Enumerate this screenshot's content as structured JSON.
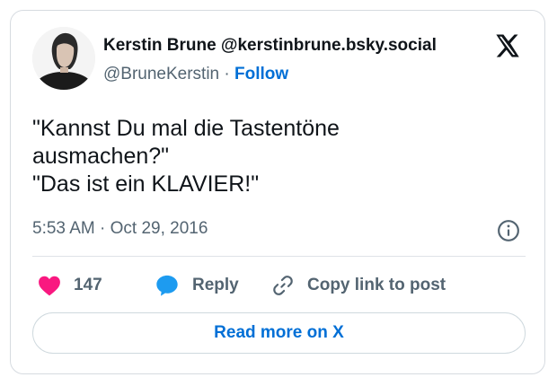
{
  "author": {
    "display_name": "Kerstin Brune",
    "bsky_handle": "@kerstinbrune.bsky.social",
    "x_handle": "@BruneKerstin",
    "separator": "·",
    "follow_label": "Follow"
  },
  "tweet": {
    "lines": [
      "\"Kannst Du mal die Tastentöne",
      "ausmachen?\"",
      "\"Das ist ein KLAVIER!\""
    ]
  },
  "meta": {
    "time": "5:53 AM",
    "separator": "·",
    "date": "Oct 29, 2016"
  },
  "actions": {
    "like_count": "147",
    "reply_label": "Reply",
    "copy_link_label": "Copy link to post"
  },
  "read_more_label": "Read more on X",
  "icons": {
    "logo": "x-logo-icon",
    "info": "info-icon",
    "like": "heart-icon",
    "reply": "speech-bubble-icon",
    "copy": "link-icon"
  },
  "colors": {
    "like": "#f91880",
    "reply": "#1d9bf0",
    "link": "#006fd6",
    "text": "#0f1419",
    "muted": "#536471"
  }
}
